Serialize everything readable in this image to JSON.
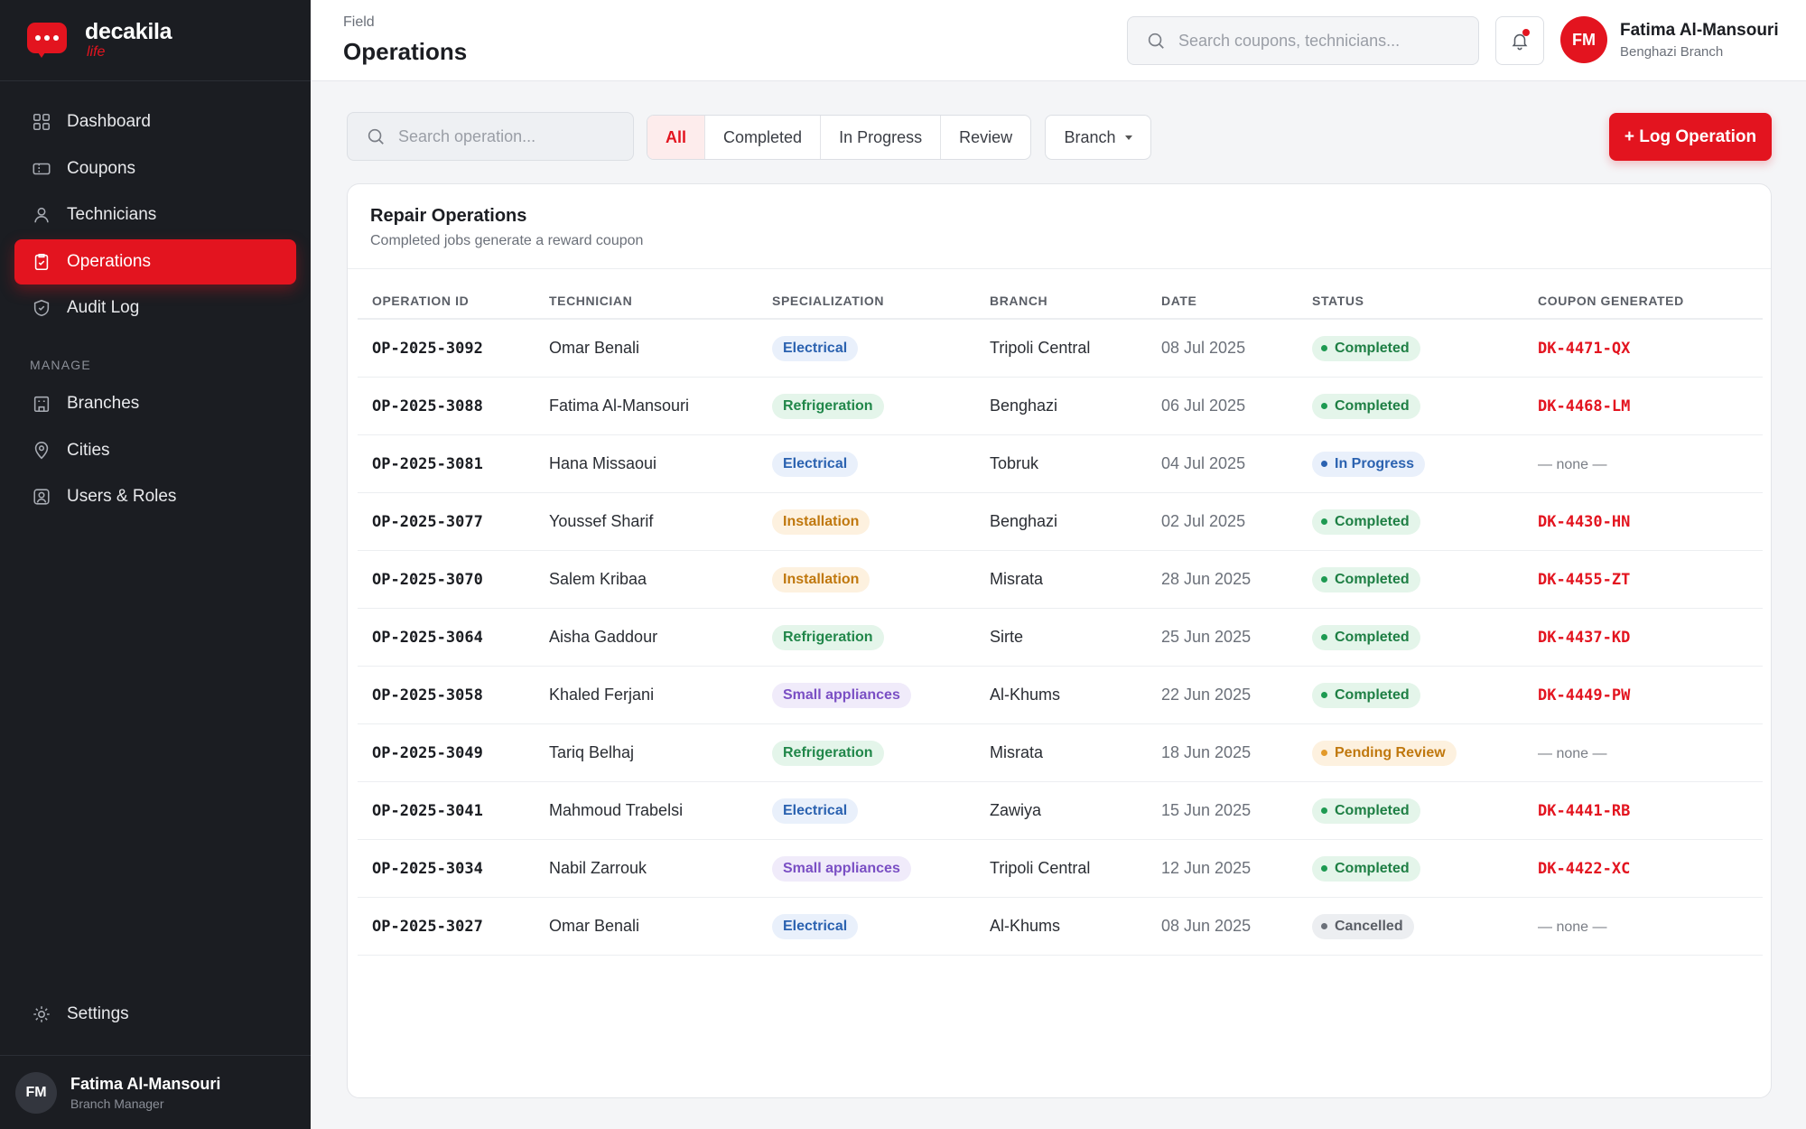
{
  "brand": {
    "name": "decakila",
    "sub": "life"
  },
  "sidebar": {
    "items": [
      {
        "label": "Dashboard",
        "icon": "grid-icon"
      },
      {
        "label": "Coupons",
        "icon": "ticket-icon"
      },
      {
        "label": "Technicians",
        "icon": "user-icon"
      },
      {
        "label": "Operations",
        "icon": "clipboard-check-icon",
        "active": true
      },
      {
        "label": "Audit Log",
        "icon": "shield-icon"
      }
    ],
    "section_label": "MANAGE",
    "manage_items": [
      {
        "label": "Branches",
        "icon": "building-icon"
      },
      {
        "label": "Cities",
        "icon": "map-pin-icon"
      },
      {
        "label": "Users & Roles",
        "icon": "users-icon"
      }
    ],
    "settings_label": "Settings",
    "user": {
      "initials": "FM",
      "name": "Fatima Al-Mansouri",
      "role": "Branch Manager"
    }
  },
  "header": {
    "breadcrumb": "Field",
    "title": "Operations",
    "search_placeholder": "Search coupons, technicians...",
    "user": {
      "initials": "FM",
      "name": "Fatima Al-Mansouri",
      "branch": "Benghazi Branch"
    }
  },
  "toolbar": {
    "search_placeholder": "Search operation...",
    "filters": [
      "All",
      "Completed",
      "In Progress",
      "Review"
    ],
    "active_filter": "All",
    "branch_label": "Branch",
    "log_button": "+ Log Operation"
  },
  "card": {
    "title": "Repair Operations",
    "subtitle": "Completed jobs generate a reward coupon"
  },
  "table": {
    "columns": [
      "OPERATION ID",
      "TECHNICIAN",
      "SPECIALIZATION",
      "BRANCH",
      "DATE",
      "STATUS",
      "COUPON GENERATED"
    ],
    "rows": [
      {
        "id": "OP-2025-3092",
        "tech": "Omar Benali",
        "spec": "Electrical",
        "branch": "Tripoli Central",
        "date": "08 Jul 2025",
        "status": "Completed",
        "coupon": "DK-4471-QX"
      },
      {
        "id": "OP-2025-3088",
        "tech": "Fatima Al-Mansouri",
        "spec": "Refrigeration",
        "branch": "Benghazi",
        "date": "06 Jul 2025",
        "status": "Completed",
        "coupon": "DK-4468-LM"
      },
      {
        "id": "OP-2025-3081",
        "tech": "Hana Missaoui",
        "spec": "Electrical",
        "branch": "Tobruk",
        "date": "04 Jul 2025",
        "status": "In Progress",
        "coupon": "— none —"
      },
      {
        "id": "OP-2025-3077",
        "tech": "Youssef Sharif",
        "spec": "Installation",
        "branch": "Benghazi",
        "date": "02 Jul 2025",
        "status": "Completed",
        "coupon": "DK-4430-HN"
      },
      {
        "id": "OP-2025-3070",
        "tech": "Salem Kribaa",
        "spec": "Installation",
        "branch": "Misrata",
        "date": "28 Jun 2025",
        "status": "Completed",
        "coupon": "DK-4455-ZT"
      },
      {
        "id": "OP-2025-3064",
        "tech": "Aisha Gaddour",
        "spec": "Refrigeration",
        "branch": "Sirte",
        "date": "25 Jun 2025",
        "status": "Completed",
        "coupon": "DK-4437-KD"
      },
      {
        "id": "OP-2025-3058",
        "tech": "Khaled Ferjani",
        "spec": "Small appliances",
        "branch": "Al-Khums",
        "date": "22 Jun 2025",
        "status": "Completed",
        "coupon": "DK-4449-PW"
      },
      {
        "id": "OP-2025-3049",
        "tech": "Tariq Belhaj",
        "spec": "Refrigeration",
        "branch": "Misrata",
        "date": "18 Jun 2025",
        "status": "Pending Review",
        "coupon": "— none —"
      },
      {
        "id": "OP-2025-3041",
        "tech": "Mahmoud Trabelsi",
        "spec": "Electrical",
        "branch": "Zawiya",
        "date": "15 Jun 2025",
        "status": "Completed",
        "coupon": "DK-4441-RB"
      },
      {
        "id": "OP-2025-3034",
        "tech": "Nabil Zarrouk",
        "spec": "Small appliances",
        "branch": "Tripoli Central",
        "date": "12 Jun 2025",
        "status": "Completed",
        "coupon": "DK-4422-XC"
      },
      {
        "id": "OP-2025-3027",
        "tech": "Omar Benali",
        "spec": "Electrical",
        "branch": "Al-Khums",
        "date": "08 Jun 2025",
        "status": "Cancelled",
        "coupon": "— none —"
      }
    ]
  },
  "colors": {
    "accent": "#e3141f",
    "sidebar_bg": "#1b1d22"
  }
}
